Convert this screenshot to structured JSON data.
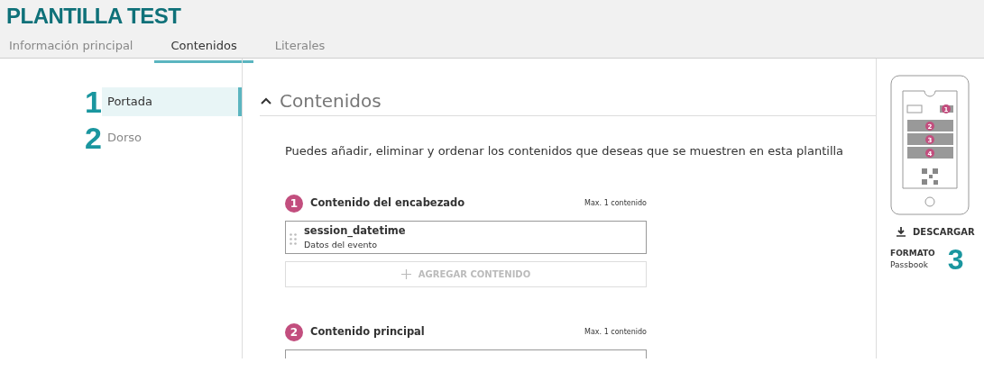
{
  "title": "PLANTILLA TEST",
  "tabs": [
    {
      "label": "Información principal",
      "selected": false
    },
    {
      "label": "Contenidos",
      "selected": true
    },
    {
      "label": "Literales",
      "selected": false
    }
  ],
  "sidebar": {
    "items": [
      {
        "number": "1",
        "label": "Portada",
        "selected": true
      },
      {
        "number": "2",
        "label": "Dorso",
        "selected": false
      }
    ]
  },
  "section": {
    "title": "Contenidos",
    "expanded": true,
    "description": "Puedes añadir, eliminar y ordenar los contenidos que deseas que se muestren en esta plantilla",
    "groups": [
      {
        "number": "1",
        "title": "Contenido del encabezado",
        "limit": "Max. 1 contenido",
        "items": [
          {
            "name": "session_datetime",
            "subtitle": "Datos del evento"
          }
        ],
        "add_button": "AGREGAR CONTENIDO"
      },
      {
        "number": "2",
        "title": "Contenido principal",
        "limit": "Max. 1 contenido",
        "items": [
          {
            "kind": "partial"
          }
        ]
      }
    ]
  },
  "preview": {
    "slots": [
      "1",
      "2",
      "3",
      "4"
    ],
    "download": "DESCARGAR",
    "format_label": "FORMATO",
    "format_value": "Passbook",
    "number": "3"
  }
}
